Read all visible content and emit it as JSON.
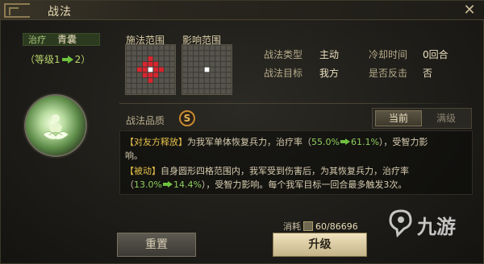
{
  "window": {
    "title": "战法"
  },
  "skill": {
    "category": "治疗",
    "name": "青囊",
    "level_prefix": "（等级1",
    "level_suffix": "2）",
    "icon": "lotus-figure-icon"
  },
  "ranges": {
    "cast_label": "施法范围",
    "effect_label": "影响范围"
  },
  "info": {
    "type_label": "战法类型",
    "type_value": "主动",
    "cooldown_label": "冷却时间",
    "cooldown_value": "0回合",
    "target_label": "战法目标",
    "target_value": "我方",
    "counter_label": "是否反击",
    "counter_value": "否"
  },
  "quality": {
    "label": "战法品质",
    "grade": "S"
  },
  "tabs": [
    {
      "label": "当前",
      "active": true
    },
    {
      "label": "满级",
      "active": false
    }
  ],
  "description": {
    "line1_tag": "【对友方释放】",
    "line1_text": "为我军单体恢复兵力，治疗率（",
    "line1_from": "55.0%",
    "line1_to": "61.1%",
    "line1_end": "），受智力影",
    "line2_text": "响。",
    "line3_tag": "【被动】",
    "line3_text": "自身圆形四格范围内，我军受到伤害后，为其恢复兵力，治疗率",
    "line4_open": "（",
    "line4_from": "13.0%",
    "line4_to": "14.4%",
    "line4_end": "），受智力影响。每个我军目标一回合最多触发3次。"
  },
  "cost": {
    "label": "消耗",
    "count": "60/86696"
  },
  "buttons": {
    "reset": "重置",
    "upgrade": "升级"
  },
  "watermark": {
    "text": "九游"
  },
  "colors": {
    "accent_gold": "#e6c14a",
    "highlight_green": "#8fce5c",
    "range_red": "#d9252f",
    "quality_orange": "#c9892e"
  }
}
